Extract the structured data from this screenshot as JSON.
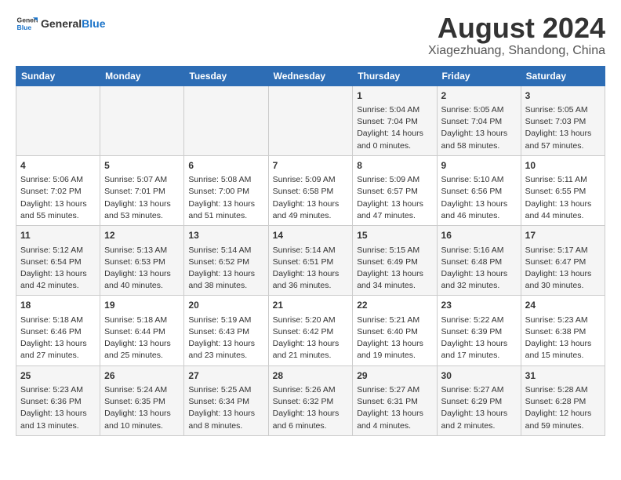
{
  "logo": {
    "general": "General",
    "blue": "Blue"
  },
  "title": "August 2024",
  "subtitle": "Xiagezhuang, Shandong, China",
  "days_of_week": [
    "Sunday",
    "Monday",
    "Tuesday",
    "Wednesday",
    "Thursday",
    "Friday",
    "Saturday"
  ],
  "weeks": [
    [
      {
        "day": "",
        "content": ""
      },
      {
        "day": "",
        "content": ""
      },
      {
        "day": "",
        "content": ""
      },
      {
        "day": "",
        "content": ""
      },
      {
        "day": "1",
        "content": "Sunrise: 5:04 AM\nSunset: 7:04 PM\nDaylight: 14 hours and 0 minutes."
      },
      {
        "day": "2",
        "content": "Sunrise: 5:05 AM\nSunset: 7:04 PM\nDaylight: 13 hours and 58 minutes."
      },
      {
        "day": "3",
        "content": "Sunrise: 5:05 AM\nSunset: 7:03 PM\nDaylight: 13 hours and 57 minutes."
      }
    ],
    [
      {
        "day": "4",
        "content": "Sunrise: 5:06 AM\nSunset: 7:02 PM\nDaylight: 13 hours and 55 minutes."
      },
      {
        "day": "5",
        "content": "Sunrise: 5:07 AM\nSunset: 7:01 PM\nDaylight: 13 hours and 53 minutes."
      },
      {
        "day": "6",
        "content": "Sunrise: 5:08 AM\nSunset: 7:00 PM\nDaylight: 13 hours and 51 minutes."
      },
      {
        "day": "7",
        "content": "Sunrise: 5:09 AM\nSunset: 6:58 PM\nDaylight: 13 hours and 49 minutes."
      },
      {
        "day": "8",
        "content": "Sunrise: 5:09 AM\nSunset: 6:57 PM\nDaylight: 13 hours and 47 minutes."
      },
      {
        "day": "9",
        "content": "Sunrise: 5:10 AM\nSunset: 6:56 PM\nDaylight: 13 hours and 46 minutes."
      },
      {
        "day": "10",
        "content": "Sunrise: 5:11 AM\nSunset: 6:55 PM\nDaylight: 13 hours and 44 minutes."
      }
    ],
    [
      {
        "day": "11",
        "content": "Sunrise: 5:12 AM\nSunset: 6:54 PM\nDaylight: 13 hours and 42 minutes."
      },
      {
        "day": "12",
        "content": "Sunrise: 5:13 AM\nSunset: 6:53 PM\nDaylight: 13 hours and 40 minutes."
      },
      {
        "day": "13",
        "content": "Sunrise: 5:14 AM\nSunset: 6:52 PM\nDaylight: 13 hours and 38 minutes."
      },
      {
        "day": "14",
        "content": "Sunrise: 5:14 AM\nSunset: 6:51 PM\nDaylight: 13 hours and 36 minutes."
      },
      {
        "day": "15",
        "content": "Sunrise: 5:15 AM\nSunset: 6:49 PM\nDaylight: 13 hours and 34 minutes."
      },
      {
        "day": "16",
        "content": "Sunrise: 5:16 AM\nSunset: 6:48 PM\nDaylight: 13 hours and 32 minutes."
      },
      {
        "day": "17",
        "content": "Sunrise: 5:17 AM\nSunset: 6:47 PM\nDaylight: 13 hours and 30 minutes."
      }
    ],
    [
      {
        "day": "18",
        "content": "Sunrise: 5:18 AM\nSunset: 6:46 PM\nDaylight: 13 hours and 27 minutes."
      },
      {
        "day": "19",
        "content": "Sunrise: 5:18 AM\nSunset: 6:44 PM\nDaylight: 13 hours and 25 minutes."
      },
      {
        "day": "20",
        "content": "Sunrise: 5:19 AM\nSunset: 6:43 PM\nDaylight: 13 hours and 23 minutes."
      },
      {
        "day": "21",
        "content": "Sunrise: 5:20 AM\nSunset: 6:42 PM\nDaylight: 13 hours and 21 minutes."
      },
      {
        "day": "22",
        "content": "Sunrise: 5:21 AM\nSunset: 6:40 PM\nDaylight: 13 hours and 19 minutes."
      },
      {
        "day": "23",
        "content": "Sunrise: 5:22 AM\nSunset: 6:39 PM\nDaylight: 13 hours and 17 minutes."
      },
      {
        "day": "24",
        "content": "Sunrise: 5:23 AM\nSunset: 6:38 PM\nDaylight: 13 hours and 15 minutes."
      }
    ],
    [
      {
        "day": "25",
        "content": "Sunrise: 5:23 AM\nSunset: 6:36 PM\nDaylight: 13 hours and 13 minutes."
      },
      {
        "day": "26",
        "content": "Sunrise: 5:24 AM\nSunset: 6:35 PM\nDaylight: 13 hours and 10 minutes."
      },
      {
        "day": "27",
        "content": "Sunrise: 5:25 AM\nSunset: 6:34 PM\nDaylight: 13 hours and 8 minutes."
      },
      {
        "day": "28",
        "content": "Sunrise: 5:26 AM\nSunset: 6:32 PM\nDaylight: 13 hours and 6 minutes."
      },
      {
        "day": "29",
        "content": "Sunrise: 5:27 AM\nSunset: 6:31 PM\nDaylight: 13 hours and 4 minutes."
      },
      {
        "day": "30",
        "content": "Sunrise: 5:27 AM\nSunset: 6:29 PM\nDaylight: 13 hours and 2 minutes."
      },
      {
        "day": "31",
        "content": "Sunrise: 5:28 AM\nSunset: 6:28 PM\nDaylight: 12 hours and 59 minutes."
      }
    ]
  ]
}
